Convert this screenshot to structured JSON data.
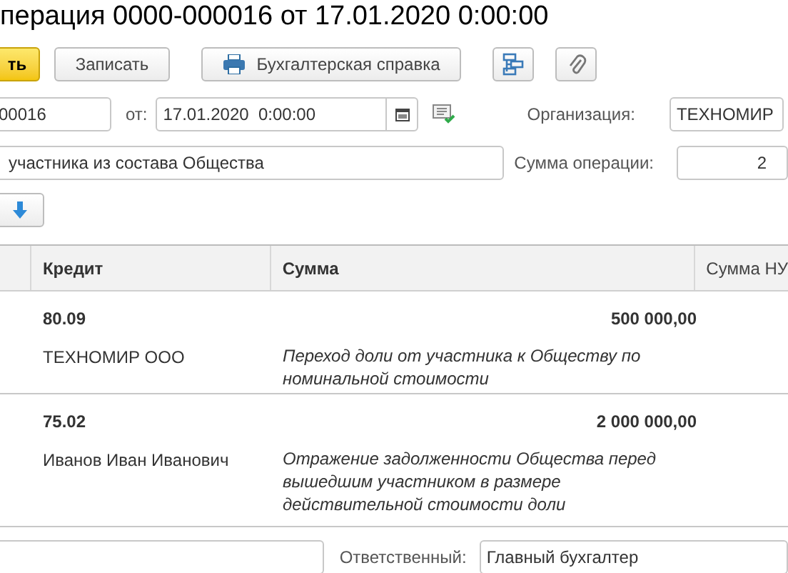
{
  "window": {
    "title": "перация 0000-000016 от 17.01.2020 0:00:00"
  },
  "toolbar": {
    "buttons": [
      {
        "kind": "primary",
        "label": "ть"
      },
      {
        "kind": "plain",
        "label": "Записать"
      },
      {
        "kind": "print",
        "label": "Бухгалтерская справка"
      },
      {
        "kind": "structure"
      },
      {
        "kind": "attach"
      }
    ]
  },
  "header": {
    "number": "00016",
    "date_label": "от:",
    "date": "17.01.2020  0:00:00",
    "organization_label": "Организация:",
    "organization": "ТЕХНОМИР",
    "content": "участника из состава Общества",
    "amount_label": "Сумма операции:",
    "amount": "2"
  },
  "table": {
    "columns": [
      "Кредит",
      "Сумма",
      "Сумма НУ"
    ],
    "rows": [
      {
        "account": "80.09",
        "amount": "500 000,00",
        "subconto": "ТЕХНОМИР ООО",
        "comment": "Переход доли от участника к Обществу по номинальной стоимости"
      },
      {
        "account": "75.02",
        "amount": "2 000 000,00",
        "subconto": "Иванов Иван Иванович",
        "comment": "Отражение задолженности Общества перед вышедшим участником в размере действительной стоимости доли"
      }
    ]
  },
  "footer": {
    "responsible_label": "Ответственный:",
    "responsible": "Главный бухгалтер"
  }
}
